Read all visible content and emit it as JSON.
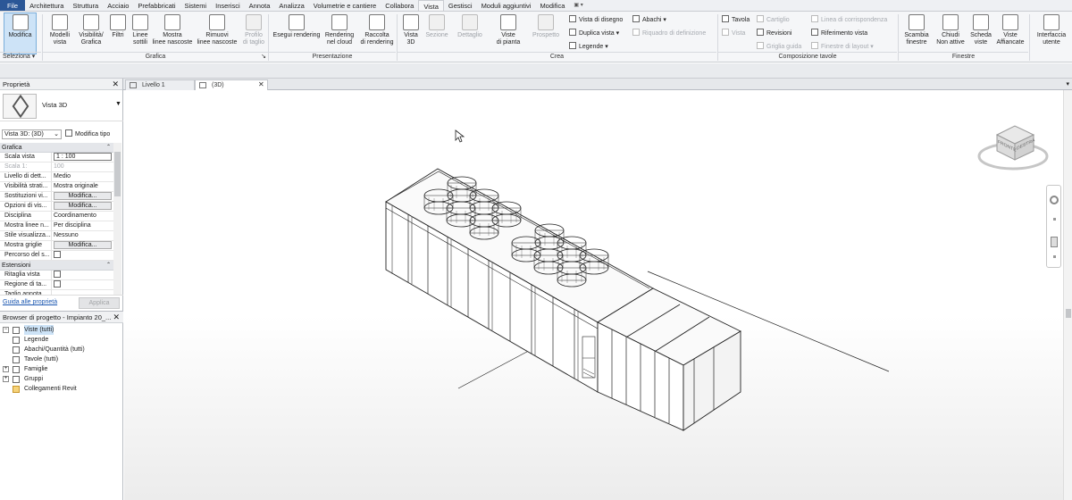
{
  "menu": [
    "File",
    "Architettura",
    "Struttura",
    "Acciaio",
    "Prefabbricati",
    "Sistemi",
    "Inserisci",
    "Annota",
    "Analizza",
    "Volumetrie e cantiere",
    "Collabora",
    "Vista",
    "Gestisci",
    "Moduli aggiuntivi",
    "Modifica",
    "▣ ▾"
  ],
  "ribbon": {
    "modifica": "Modifica",
    "seleziona": "Seleziona ▾",
    "grafica": {
      "title": "Grafica",
      "expand": "↘",
      "modelli": "Modelli\nvista",
      "visibilita": "Visibilità/\nGrafica",
      "filtri": "Filtri",
      "linee": "Linee\nsottili",
      "mostra": "Mostra\nlinee nascoste",
      "rimuovi": "Rimuovi\nlinee nascoste",
      "profilo": "Profilo\ndi taglio"
    },
    "presentazione": {
      "title": "Presentazione",
      "esegui": "Esegui rendering",
      "cloud": "Rendering\nnel cloud",
      "raccolta": "Raccolta\ndi rendering"
    },
    "crea": {
      "title": "Crea",
      "vista3d": "Vista\n3D",
      "sezione": "Sezione",
      "dettaglio": "Dettaglio",
      "viste_pianta": "Viste\ndi pianta",
      "prospetto": "Prospetto",
      "vista_disegno": "Vista di disegno",
      "duplica": "Duplica vista ▾",
      "legende": "Legende ▾",
      "abachi": "Abachi ▾",
      "riquadro": "Riquadro di definizione"
    },
    "composizione": {
      "title": "Composizione tavole",
      "tavola": "Tavola",
      "vista": "Vista",
      "cartiglio": "Cartiglio",
      "revisioni": "Revisioni",
      "griglia": "Griglia guida",
      "linea": "Linea di corrispondenza",
      "riferimento": "Riferimento vista",
      "finestre_layout": "Finestre di layout ▾"
    },
    "finestre": {
      "title": "Finestre",
      "scambia": "Scambia\nfinestre",
      "chiudi": "Chiudi\nNon attive",
      "scheda": "Scheda\nviste",
      "affiancate": "Viste\nAffiancate"
    },
    "interfaccia": "Interfaccia\nutente"
  },
  "properties": {
    "title": "Proprietà",
    "type_name": "Vista 3D",
    "selector": "Vista 3D: (3D)",
    "modifica_tipo": "Modifica tipo",
    "group_grafica": "Grafica",
    "rows": [
      {
        "k": "Scala vista",
        "v": "1 : 100"
      },
      {
        "k": "Scala  1:",
        "v": "100"
      },
      {
        "k": "Livello di dett...",
        "v": "Medio"
      },
      {
        "k": "Visibilità strati...",
        "v": "Mostra originale"
      },
      {
        "k": "Sostituzioni vi...",
        "v": "Modifica..."
      },
      {
        "k": "Opzioni di vis...",
        "v": "Modifica..."
      },
      {
        "k": "Disciplina",
        "v": "Coordinamento"
      },
      {
        "k": "Mostra linee n...",
        "v": "Per disciplina"
      },
      {
        "k": "Stile visualizza...",
        "v": "Nessuno"
      },
      {
        "k": "Mostra griglie",
        "v": "Modifica..."
      },
      {
        "k": "Percorso del s...",
        "v": ""
      }
    ],
    "group_estensioni": "Estensioni",
    "rows2": [
      {
        "k": "Ritaglia vista",
        "v": ""
      },
      {
        "k": "Regione di ta...",
        "v": ""
      },
      {
        "k": "Taglio annota...",
        "v": ""
      }
    ],
    "help": "Guida alle proprietà",
    "apply": "Applica"
  },
  "browser": {
    "title": "Browser di progetto - Impianto 20_...",
    "items": [
      "Viste (tutti)",
      "Legende",
      "Abachi/Quantità (tutti)",
      "Tavole (tutti)",
      "Famiglie",
      "Gruppi",
      "Collegamenti Revit"
    ]
  },
  "tabs": [
    {
      "label": "Livello 1"
    },
    {
      "label": "(3D)"
    }
  ],
  "viewcube": {
    "left": "FRONTE",
    "right": "DESTRA"
  }
}
